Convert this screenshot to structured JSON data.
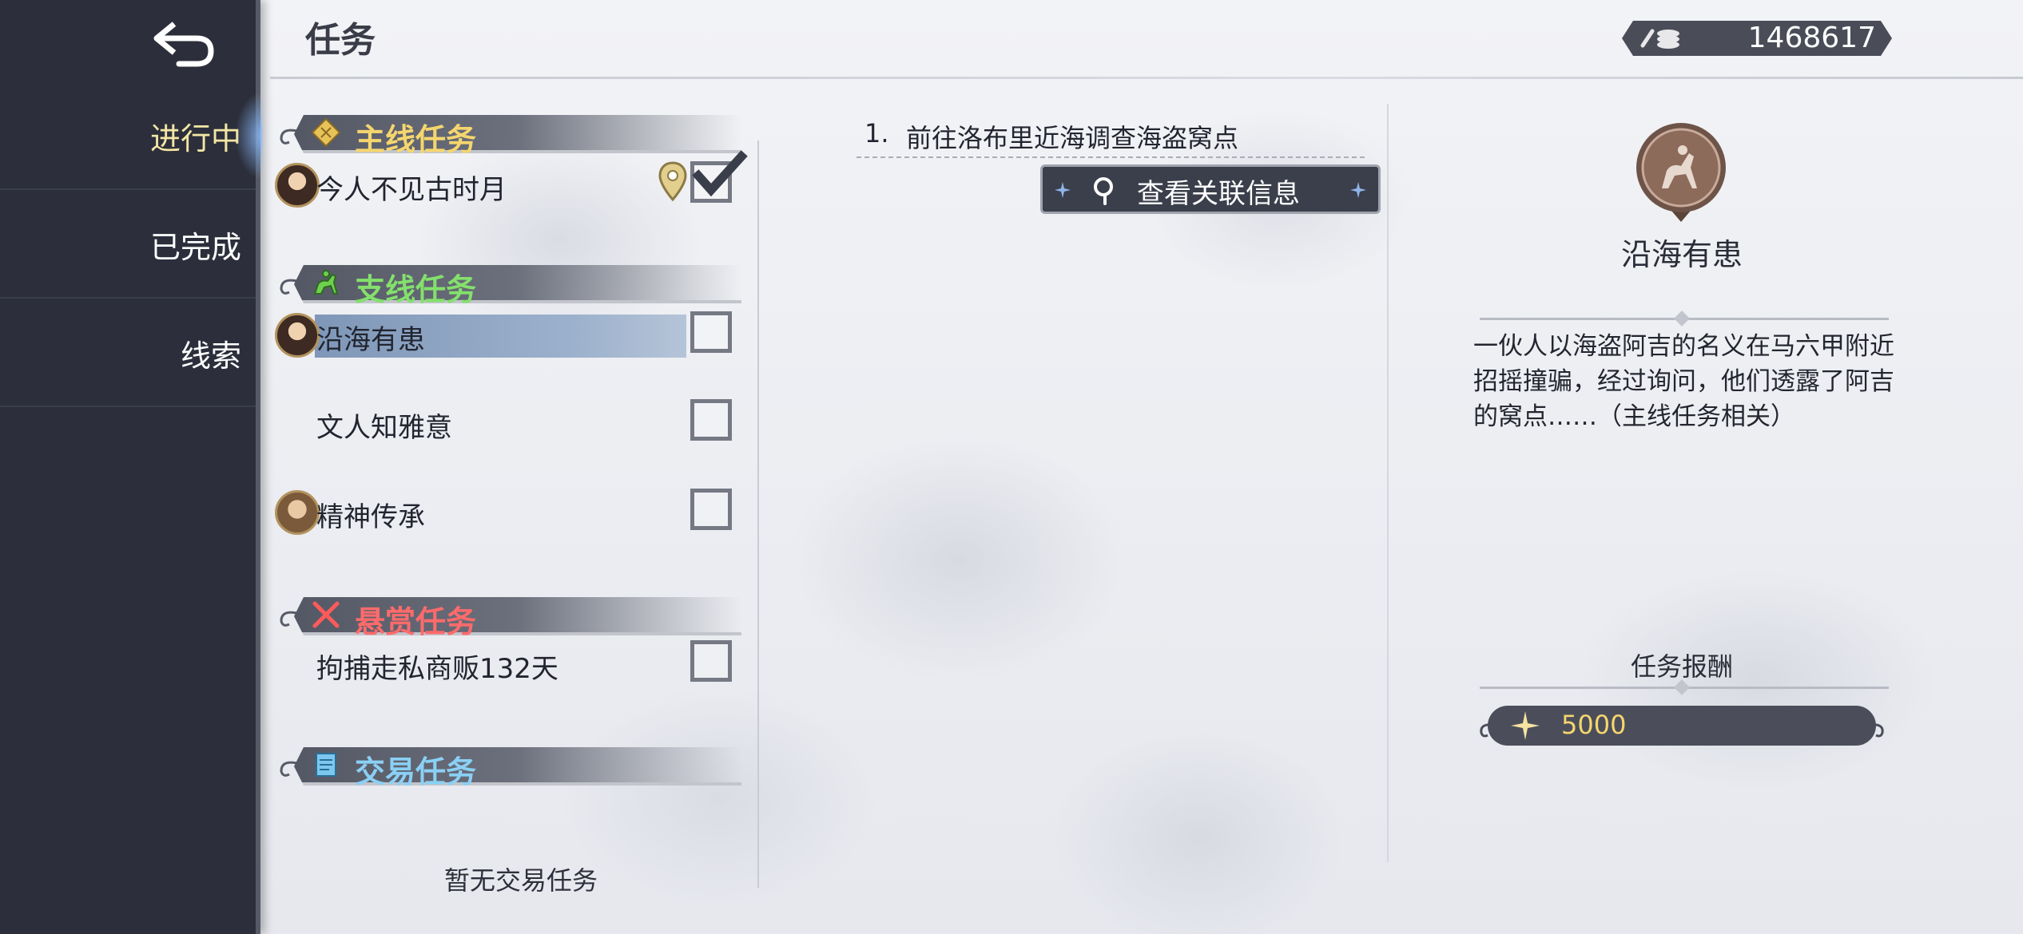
{
  "header": {
    "title": "任务",
    "currency_value": "1468617"
  },
  "sidebar": {
    "items": [
      {
        "label": "进行中",
        "active": true
      },
      {
        "label": "已完成",
        "active": false
      },
      {
        "label": "线索",
        "active": false
      }
    ]
  },
  "quest_list": {
    "sections": [
      {
        "label": "主线任务",
        "color": "#f5d66e",
        "icon": "compass-icon"
      },
      {
        "label": "支线任务",
        "color": "#84e06c",
        "icon": "horse-rider-icon"
      },
      {
        "label": "悬赏任务",
        "color": "#ff6b6b",
        "icon": "crossed-swords-icon"
      },
      {
        "label": "交易任务",
        "color": "#8ad0f5",
        "icon": "scroll-icon"
      }
    ],
    "main_quests": [
      {
        "name": "今人不见古时月",
        "tracked": true,
        "has_location": true
      }
    ],
    "side_quests": [
      {
        "name": "沿海有患",
        "selected": true,
        "tracked": false
      },
      {
        "name": "文人知雅意",
        "tracked": false
      },
      {
        "name": "精神传承",
        "tracked": false
      }
    ],
    "bounty_quests": [
      {
        "name": "拘捕走私商贩132天",
        "tracked": false
      }
    ],
    "trade_empty_text": "暂无交易任务"
  },
  "objective": {
    "number": "1.",
    "text": "前往洛布里近海调查海盗窝点",
    "related_button_label": "查看关联信息"
  },
  "detail": {
    "title": "沿海有患",
    "description": "一伙人以海盗阿吉的名义在马六甲附近招摇撞骗，经过询问，他们透露了阿吉的窝点……（主线任务相关）",
    "reward_title": "任务报酬",
    "reward_value": "5000"
  }
}
